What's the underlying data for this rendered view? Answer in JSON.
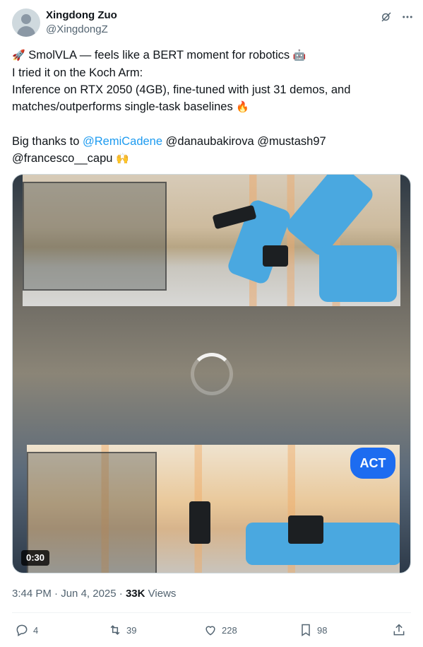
{
  "author": {
    "display_name": "Xingdong Zuo",
    "handle": "@XingdongZ"
  },
  "header_icons": [
    "grok-icon",
    "more-icon"
  ],
  "tweet": {
    "line1_emoji": "🚀",
    "line1_text": "SmolVLA — feels like a BERT moment for robotics",
    "line1_end_emoji": "🤖",
    "line2": "I tried it on the Koch Arm:",
    "line3": "Inference on RTX 2050 (4GB), fine-tuned with just 31 demos, and",
    "line4_text": "matches/outperforms single-task baselines",
    "line4_emoji": "🔥",
    "thanks_prefix": "Big thanks to",
    "mention1": "@RemiCadene",
    "mention_rest": "@danaubakirova @mustash97",
    "line7_text": "@francesco__capu",
    "line7_emoji": "🙌"
  },
  "media": {
    "badge": "ACT",
    "duration": "0:30"
  },
  "meta": {
    "time": "3:44 PM",
    "separator": "·",
    "date": "Jun 4, 2025",
    "views_count": "33K",
    "views_label": "Views"
  },
  "actions": {
    "replies": "4",
    "reposts": "39",
    "likes": "228",
    "bookmarks": "98"
  },
  "colors": {
    "link": "#1d9bf0",
    "secondary": "#536471",
    "text": "#0f1419",
    "badge": "#1d6cf0"
  }
}
